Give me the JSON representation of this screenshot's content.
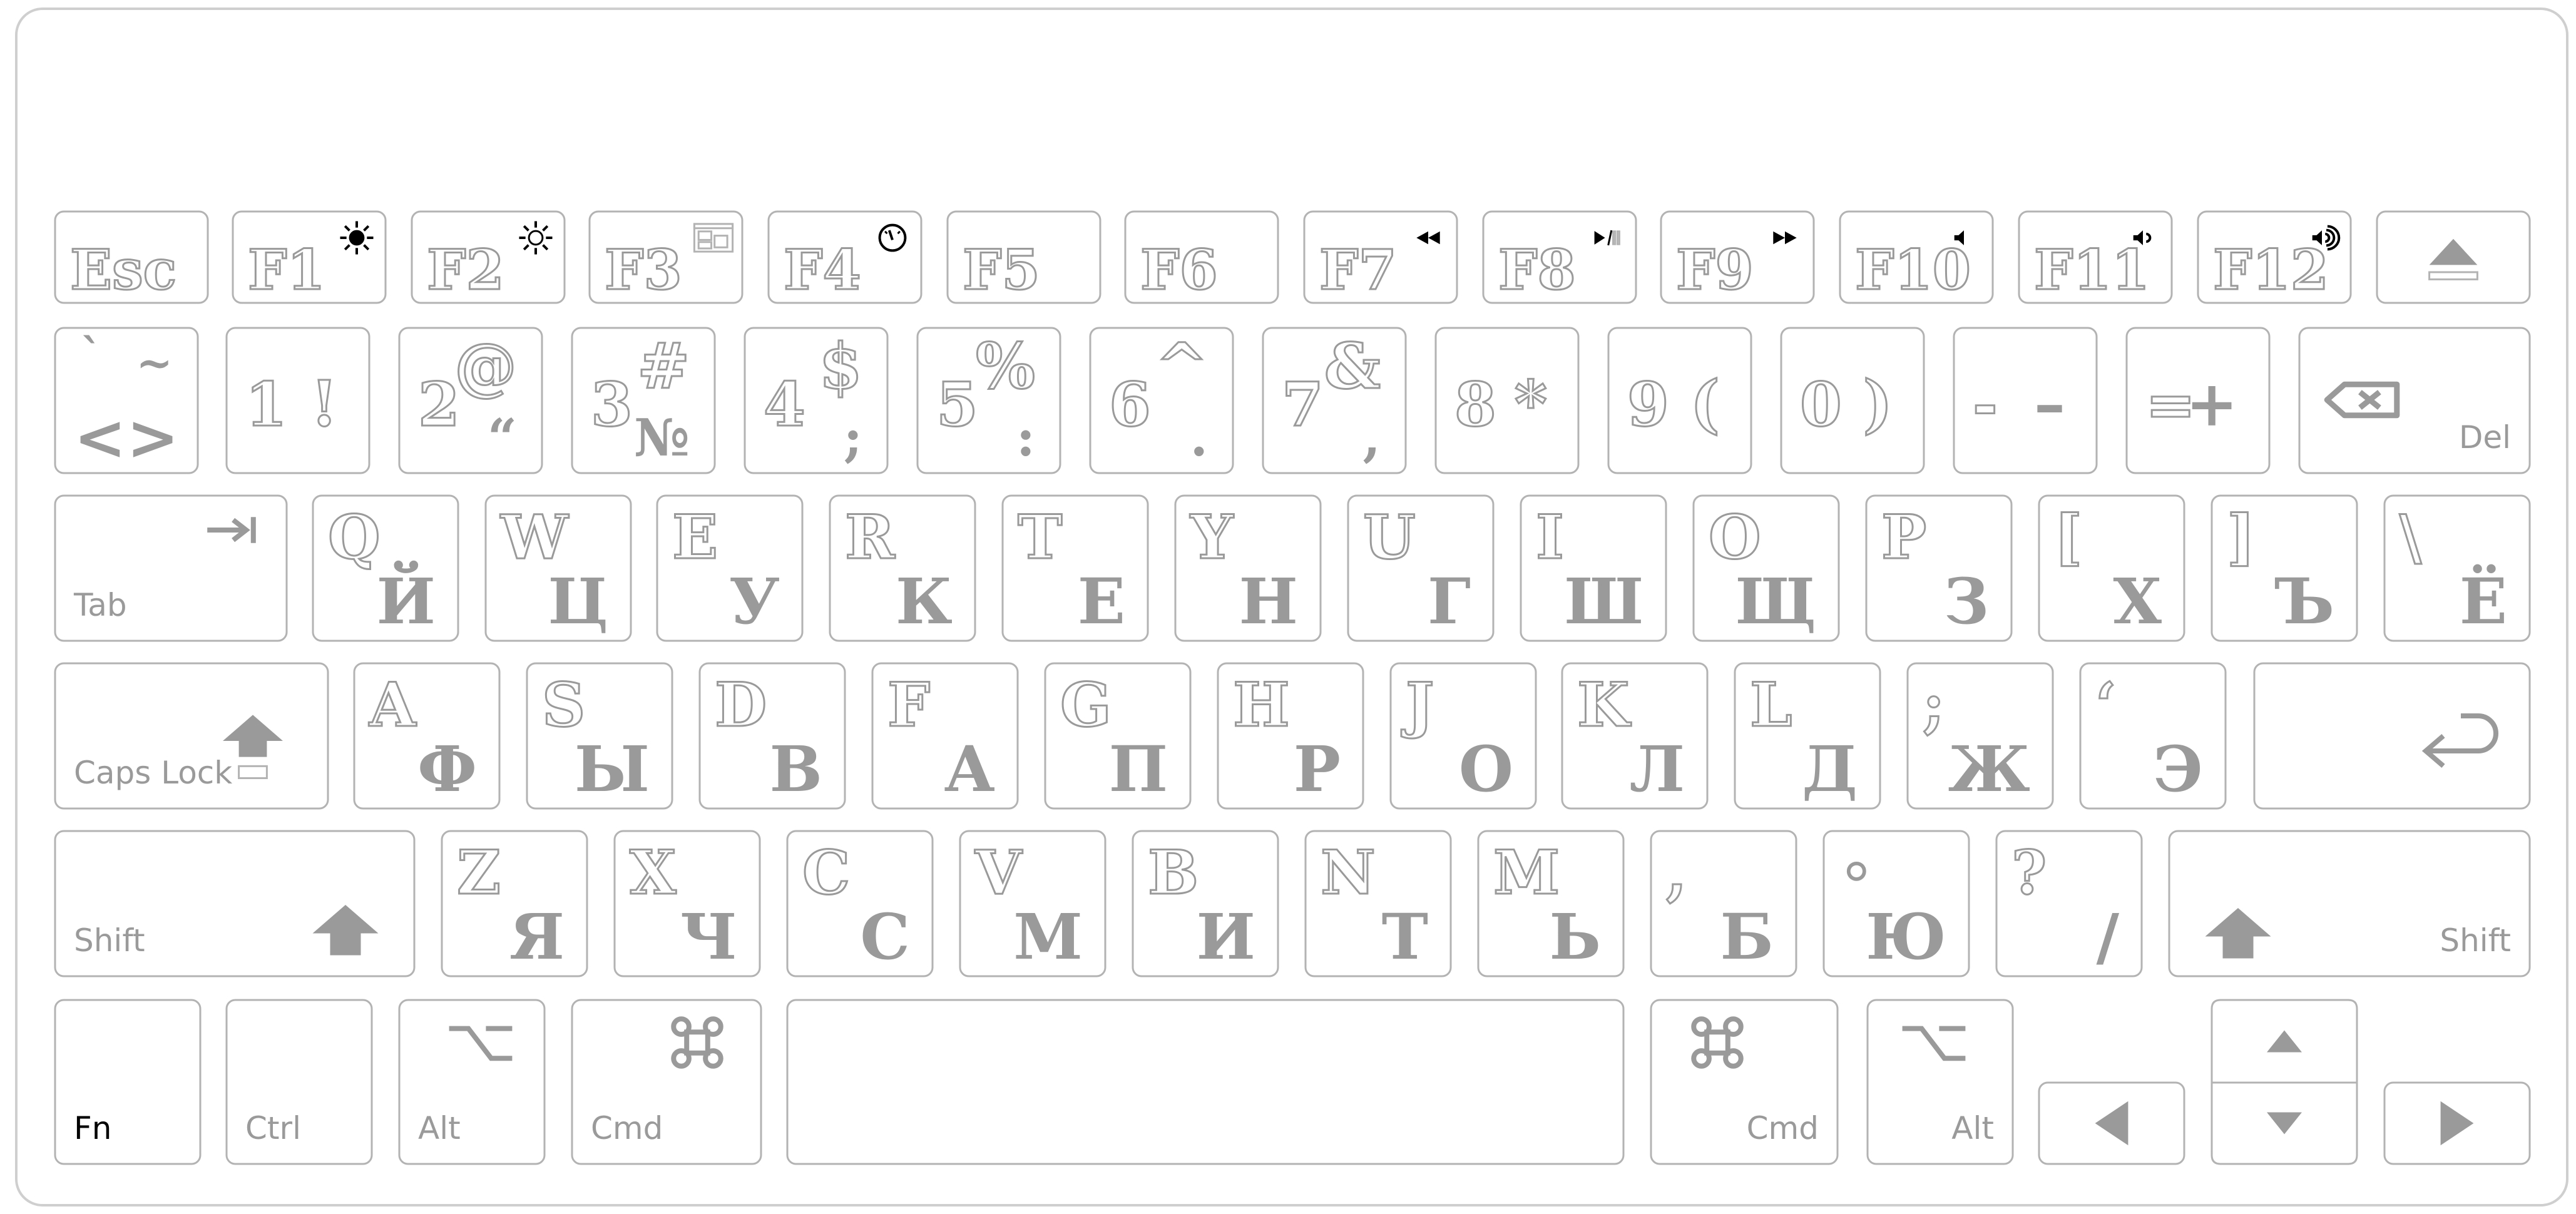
{
  "keyboard": {
    "layout": "ru",
    "colors": {
      "key_border": "#b3b3b3",
      "label": "#9a9a9a",
      "media_icon": "#000000",
      "frame_border": "#cfcfcf"
    },
    "rows": [
      {
        "name": "function-row",
        "keys": [
          {
            "id": "esc",
            "main": "Esc"
          },
          {
            "id": "f1",
            "main": "F1",
            "icon": "brightness-down-icon"
          },
          {
            "id": "f2",
            "main": "F2",
            "icon": "brightness-up-icon"
          },
          {
            "id": "f3",
            "main": "F3",
            "icon": "mission-control-icon"
          },
          {
            "id": "f4",
            "main": "F4",
            "icon": "dashboard-icon"
          },
          {
            "id": "f5",
            "main": "F5"
          },
          {
            "id": "f6",
            "main": "F6"
          },
          {
            "id": "f7",
            "main": "F7",
            "icon": "rewind-icon"
          },
          {
            "id": "f8",
            "main": "F8",
            "icon": "play-pause-icon"
          },
          {
            "id": "f9",
            "main": "F9",
            "icon": "fast-forward-icon"
          },
          {
            "id": "f10",
            "main": "F10",
            "icon": "mute-icon"
          },
          {
            "id": "f11",
            "main": "F11",
            "icon": "volume-down-icon"
          },
          {
            "id": "f12",
            "main": "F12",
            "icon": "volume-up-icon"
          },
          {
            "id": "eject",
            "icon": "eject-icon"
          }
        ]
      },
      {
        "name": "number-row",
        "keys": [
          {
            "id": "grave",
            "tl": "`",
            "tr": "~",
            "bl": "<",
            "br": ">"
          },
          {
            "id": "1",
            "lat": "1",
            "sym": "!"
          },
          {
            "id": "2",
            "lat": "2",
            "sym": "@",
            "rus": "“"
          },
          {
            "id": "3",
            "lat": "3",
            "sym": "#",
            "rus": "№"
          },
          {
            "id": "4",
            "lat": "4",
            "sym": "$",
            "rus": ";"
          },
          {
            "id": "5",
            "lat": "5",
            "sym": "%",
            "rus": ":"
          },
          {
            "id": "6",
            "lat": "6",
            "sym": "^",
            "rus": "."
          },
          {
            "id": "7",
            "lat": "7",
            "sym": "&",
            "rus": ","
          },
          {
            "id": "8",
            "lat": "8",
            "sym": "*"
          },
          {
            "id": "9",
            "lat": "9",
            "sym": "("
          },
          {
            "id": "0",
            "lat": "0",
            "sym": ")"
          },
          {
            "id": "minus",
            "lat": "-",
            "sym": "–"
          },
          {
            "id": "equal",
            "lat": "=",
            "sym": "+"
          },
          {
            "id": "del",
            "label": "Del",
            "icon": "backspace-icon"
          }
        ]
      },
      {
        "name": "qwerty-row",
        "keys": [
          {
            "id": "tab",
            "label": "Tab",
            "icon": "tab-arrow-icon"
          },
          {
            "id": "q",
            "lat": "Q",
            "rus": "Й"
          },
          {
            "id": "w",
            "lat": "W",
            "rus": "Ц"
          },
          {
            "id": "e",
            "lat": "E",
            "rus": "У"
          },
          {
            "id": "r",
            "lat": "R",
            "rus": "К"
          },
          {
            "id": "t",
            "lat": "T",
            "rus": "Е"
          },
          {
            "id": "y",
            "lat": "Y",
            "rus": "Н"
          },
          {
            "id": "u",
            "lat": "U",
            "rus": "Г"
          },
          {
            "id": "i",
            "lat": "I",
            "rus": "Ш"
          },
          {
            "id": "o",
            "lat": "O",
            "rus": "Щ"
          },
          {
            "id": "p",
            "lat": "P",
            "rus": "З"
          },
          {
            "id": "lbracket",
            "lat": "[",
            "rus": "Х"
          },
          {
            "id": "rbracket",
            "lat": "]",
            "rus": "Ъ"
          },
          {
            "id": "backslash",
            "lat": "\\",
            "rus": "Ё"
          }
        ]
      },
      {
        "name": "home-row",
        "keys": [
          {
            "id": "caps",
            "label": "Caps Lock",
            "icon": "caps-lock-icon"
          },
          {
            "id": "a",
            "lat": "A",
            "rus": "Ф"
          },
          {
            "id": "s",
            "lat": "S",
            "rus": "Ы"
          },
          {
            "id": "d",
            "lat": "D",
            "rus": "В"
          },
          {
            "id": "f",
            "lat": "F",
            "rus": "А"
          },
          {
            "id": "g",
            "lat": "G",
            "rus": "П"
          },
          {
            "id": "h",
            "lat": "H",
            "rus": "Р"
          },
          {
            "id": "j",
            "lat": "J",
            "rus": "О"
          },
          {
            "id": "k",
            "lat": "K",
            "rus": "Л"
          },
          {
            "id": "l",
            "lat": "L",
            "rus": "Д"
          },
          {
            "id": "semicolon",
            "lat": ";",
            "rus": "Ж"
          },
          {
            "id": "quote",
            "lat": "‘",
            "rus": "Э"
          },
          {
            "id": "enter",
            "icon": "return-icon"
          }
        ]
      },
      {
        "name": "shift-row",
        "keys": [
          {
            "id": "lshift",
            "label": "Shift",
            "icon": "shift-icon"
          },
          {
            "id": "z",
            "lat": "Z",
            "rus": "Я"
          },
          {
            "id": "x",
            "lat": "X",
            "rus": "Ч"
          },
          {
            "id": "c",
            "lat": "C",
            "rus": "С"
          },
          {
            "id": "v",
            "lat": "V",
            "rus": "М"
          },
          {
            "id": "b",
            "lat": "B",
            "rus": "И"
          },
          {
            "id": "n",
            "lat": "N",
            "rus": "Т"
          },
          {
            "id": "m",
            "lat": "M",
            "rus": "Ь"
          },
          {
            "id": "comma",
            "lat": ",",
            "rus": "Б"
          },
          {
            "id": "period",
            "lat": "◦",
            "rus": "Ю"
          },
          {
            "id": "slash",
            "lat": "?",
            "rus": "/"
          },
          {
            "id": "rshift",
            "label": "Shift",
            "icon": "shift-icon"
          }
        ]
      },
      {
        "name": "bottom-row",
        "keys": [
          {
            "id": "fn",
            "label": "Fn"
          },
          {
            "id": "ctrl",
            "label": "Ctrl"
          },
          {
            "id": "lalt",
            "label": "Alt",
            "icon": "option-icon"
          },
          {
            "id": "lcmd",
            "label": "Cmd",
            "icon": "command-icon"
          },
          {
            "id": "space"
          },
          {
            "id": "rcmd",
            "label": "Cmd",
            "icon": "command-icon"
          },
          {
            "id": "ralt",
            "label": "Alt",
            "icon": "option-icon"
          },
          {
            "id": "left",
            "icon": "arrow-left-icon"
          },
          {
            "id": "up",
            "icon": "arrow-up-icon"
          },
          {
            "id": "down",
            "icon": "arrow-down-icon"
          },
          {
            "id": "right",
            "icon": "arrow-right-icon"
          }
        ]
      }
    ]
  }
}
